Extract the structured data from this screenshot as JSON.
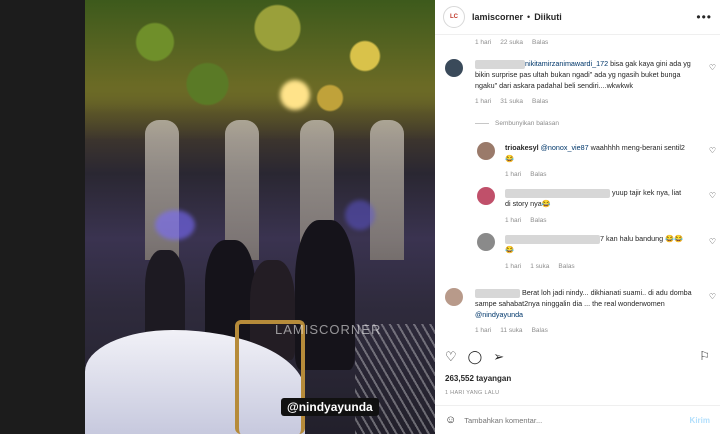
{
  "header": {
    "username": "lamiscorner",
    "separator": "•",
    "follow_label": "Diikuti",
    "more": "•••"
  },
  "video": {
    "watermark": "LAMISCORNER",
    "tag": "@nindyayunda"
  },
  "comments": [
    {
      "meta": [
        "1 hari",
        "22 suka",
        "Balas"
      ]
    },
    {
      "user": "nikitamirzanimawardi_172",
      "text": " bisa gak kaya gini ada yg bikin surprise pas ultah bukan ngadi\" ada yg ngasih buket bunga ngaku\" dari askara padahal beli sendiri....wkwkwk",
      "meta": [
        "1 hari",
        "31 suka",
        "Balas"
      ]
    }
  ],
  "hide_replies": "Sembunyikan balasan",
  "replies": [
    {
      "user": "trioakesyl",
      "mention": "@nonox_vie87",
      "text": " waahhhh meng-berani sentil2😂",
      "meta": [
        "1 hari",
        "Balas"
      ]
    },
    {
      "text": "yuup tajir kek nya, liat di story nya😂",
      "meta": [
        "1 hari",
        "Balas"
      ]
    },
    {
      "text": "7 kan halu bandung 😂😂😂",
      "meta": [
        "1 hari",
        "1 suka",
        "Balas"
      ]
    }
  ],
  "comment3": {
    "text": "Berat loh jadi nindy... dikhianati suami.. di adu domba sampe sahabat2nya ninggalin dia ... the real wonderwomen ",
    "mention": "@nindyayunda",
    "meta": [
      "1 hari",
      "11 suka",
      "Balas"
    ]
  },
  "stats": {
    "views": "263,552 tayangan",
    "date": "1 HARI YANG LALU"
  },
  "add_comment": {
    "placeholder": "Tambahkan komentar...",
    "send": "Kirim"
  },
  "icons": {
    "like": "heart-icon",
    "comment": "comment-icon",
    "share": "share-icon",
    "save": "bookmark-icon",
    "emoji": "emoji-icon"
  }
}
